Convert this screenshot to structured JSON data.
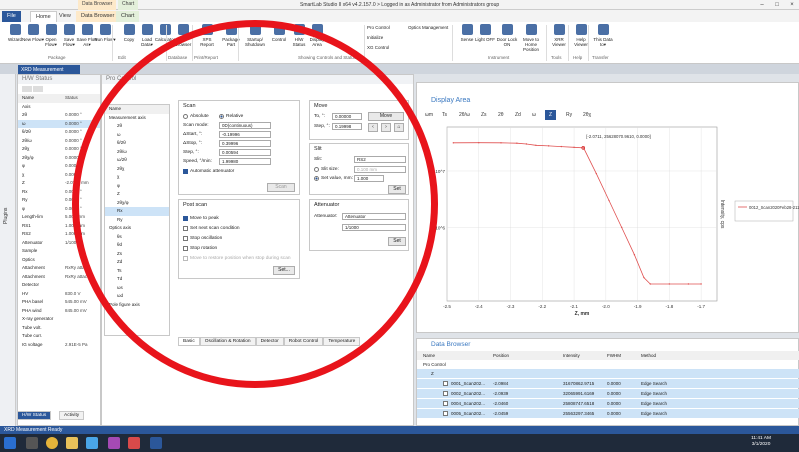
{
  "titlebar": {
    "title": "SmartLab Studio II x64 v4.2.157.0  > Logged in as Administrator from Administrators group",
    "ctx_tabs": [
      "Data Browser",
      "Chart"
    ]
  },
  "ribbon_tabs": [
    "File",
    "Home",
    "View",
    "Data Browser",
    "Chart"
  ],
  "ribbon": {
    "buttons": [
      {
        "label": "Wizard",
        "icon": "wizard-icon"
      },
      {
        "label": "New Flow▾",
        "icon": "new-flow-icon"
      },
      {
        "label": "Open Flow▾",
        "icon": "open-flow-icon"
      },
      {
        "label": "Save Flow▾",
        "icon": "save-flow-icon"
      },
      {
        "label": "Save Flow As▾",
        "icon": "save-flow-as-icon"
      },
      {
        "label": "Run Flow▾",
        "icon": "run-flow-icon"
      },
      {
        "label": "Copy",
        "icon": "copy-icon"
      },
      {
        "label": "Load Data▾",
        "icon": "load-data-icon"
      },
      {
        "label": "Calculator",
        "icon": "calculator-icon"
      },
      {
        "label": "DB Browser",
        "icon": "db-browser-icon"
      },
      {
        "label": "XPS Report",
        "icon": "xps-report-icon"
      },
      {
        "label": "Package Part",
        "icon": "package-part-icon"
      },
      {
        "label": "Startup/ Shutdown",
        "icon": "startup-icon"
      },
      {
        "label": "Control",
        "icon": "control-icon"
      },
      {
        "label": "H/W Status",
        "icon": "hw-status-icon"
      },
      {
        "label": "Display Area",
        "icon": "display-area-icon"
      },
      {
        "label": "Sense",
        "icon": "sense-icon"
      },
      {
        "label": "Light OFF",
        "icon": "light-icon"
      },
      {
        "label": "Door Lock ON",
        "icon": "door-lock-icon"
      },
      {
        "label": "Move to Home Position",
        "icon": "home-position-icon"
      },
      {
        "label": "XRR Viewer",
        "icon": "xrr-viewer-icon"
      },
      {
        "label": "Help Viewer",
        "icon": "help-viewer-icon"
      },
      {
        "label": "This Data to▾",
        "icon": "transfer-icon"
      }
    ],
    "small_cmds": [
      "Pro Control",
      "Initialize",
      "XG Control",
      "Optics Management"
    ],
    "groups": [
      "Package",
      "Edit",
      "Database",
      "Print/Report",
      "Showing Controls and Status",
      "Instrument",
      "Tools",
      "Help",
      "Transfer"
    ]
  },
  "doc_tab": "XRD Measurement",
  "plugins_label": "Plugins",
  "hw_status": {
    "title": "H/W Status",
    "col_name": "Name",
    "col_status": "Status",
    "rows": [
      {
        "name": "Axis",
        "value": ""
      },
      {
        "name": "2θ",
        "value": "0.0000 °"
      },
      {
        "name": "ω",
        "value": "0.0000 °"
      },
      {
        "name": "θ/2θ",
        "value": "0.0000 °"
      },
      {
        "name": "2θ/ω",
        "value": "0.0000 °"
      },
      {
        "name": "2θχ",
        "value": "0.0000 °"
      },
      {
        "name": "2θχ/φ",
        "value": "0.0000 °"
      },
      {
        "name": "φ",
        "value": "0.0000 °"
      },
      {
        "name": "χ",
        "value": "0.0000 °"
      },
      {
        "name": "Z",
        "value": "-2.0711 mm"
      },
      {
        "name": "Rx",
        "value": "0.0000 °"
      },
      {
        "name": "Ry",
        "value": "0.0000 °"
      },
      {
        "name": "φ",
        "value": "0.0000 °"
      },
      {
        "name": "Length-lim",
        "value": "5.000 mm"
      },
      {
        "name": "RS1",
        "value": "1.000 mm"
      },
      {
        "name": "RS2",
        "value": "1.000 mm"
      },
      {
        "name": "Attenuator",
        "value": "1/1000"
      },
      {
        "name": "Sample",
        "value": ""
      },
      {
        "name": "Optics",
        "value": ""
      },
      {
        "name": "Attachment",
        "value": "RxRy attac..."
      },
      {
        "name": "Attachment",
        "value": "RxRy attac..."
      },
      {
        "name": "Detector",
        "value": ""
      },
      {
        "name": "HV",
        "value": "830.0 V"
      },
      {
        "name": "PHA basel",
        "value": "545.00 mV"
      },
      {
        "name": "PHA wind",
        "value": "845.00 mV"
      },
      {
        "name": "X-ray generator",
        "value": ""
      },
      {
        "name": "Tube volt.",
        "value": ""
      },
      {
        "name": "Tube curr.",
        "value": ""
      },
      {
        "name": "IG voltage",
        "value": "2.91E-5 Pa"
      }
    ],
    "tabs": [
      "H/W Status",
      "Activity"
    ]
  },
  "measurement_control": {
    "title": "Pro Control",
    "tree_header": "Name",
    "tree_group1": "Measurement axis",
    "axes": [
      "2θ",
      "ω",
      "θ/2θ",
      "2θ/ω",
      "ω/2θ",
      "2θχ",
      "χ",
      "φ",
      "Z",
      "2θχ/φ",
      "Rx",
      "Ry"
    ],
    "tree_group2": "Optics axis",
    "optics": [
      "θs",
      "θd",
      "Zs",
      "Zd",
      "Ts",
      "Td",
      "ωs",
      "ωd"
    ],
    "tree_group3": "Pole figure axis",
    "scan": {
      "title": "Scan",
      "absolute": "Absolute",
      "relative": "Relative",
      "mode_label": "Scan mode:",
      "mode_value": "0D(continuous)",
      "start_label": "ΔStart, °:",
      "start_value": "-0.19996",
      "stop_label": "ΔStop, °:",
      "stop_value": "0.39996",
      "step_label": "Step, °:",
      "step_value": "0.00594",
      "speed_label": "Speed, °/min:",
      "speed_value": "1.99980",
      "auto_att": "Automatic attenuator",
      "scan_btn": "Scan"
    },
    "post_scan": {
      "title": "Post scan",
      "opts": [
        "Move to peak",
        "Set next scan condition",
        "Stop oscillation",
        "Stop rotation",
        "Move to restore position when stop during scan"
      ],
      "set_btn": "Set..."
    },
    "move": {
      "title": "Move",
      "to_label": "To, °:",
      "to_value": "0.00000",
      "step_label": "Step, °:",
      "step_value": "0.19998",
      "move_btn": "Move"
    },
    "slit": {
      "title": "Slit",
      "slit_label": "Slit:",
      "slit_value": "RS2",
      "slit_size": "Slit size:",
      "slit_size_val": "0.100 mm",
      "set_value": "Set value, mm:",
      "set_value_val": "1.000",
      "set_btn": "Set"
    },
    "attenuator": {
      "title": "Attenuator",
      "label": "Attenuator:",
      "value": "Attenuator",
      "ratio": "1/1000",
      "set_btn": "Set"
    },
    "bottom_tabs": [
      "Basic",
      "Oscillation & Rotation",
      "Detector",
      "Robot Control",
      "Temperature"
    ]
  },
  "display_area": {
    "title": "Display Area",
    "tabs": [
      "ωm",
      "Ts",
      "2θ/ω",
      "Zs",
      "2θ",
      "Zd",
      "ω",
      "Z",
      "Ry",
      "2θχ"
    ],
    "active_tab": "Z"
  },
  "chart_data": {
    "type": "line",
    "xlabel": "Z, mm",
    "ylabel": "Intensity, cps",
    "xlim": [
      -2.5,
      -1.65
    ],
    "x_ticks": [
      "-2.5",
      "-2.4",
      "-2.3",
      "-2.2",
      "-2.1",
      "-2.0",
      "-1.9",
      "-1.8",
      "-1.7"
    ],
    "y_ticks": [
      "10^8",
      "10^7",
      "10^6"
    ],
    "log_y": true,
    "legend": "0012_Scan2020Feb28-211904",
    "annotation": "[-2.0711, 25628070.9610, 0.0000]",
    "series": [
      {
        "name": "0012_Scan2020Feb28-211904",
        "color": "#e05050",
        "x": [
          -2.48,
          -2.4,
          -2.33,
          -2.28,
          -2.25,
          -2.22,
          -2.18,
          -2.14,
          -2.1,
          -2.07,
          -2.03,
          -1.99,
          -1.95,
          -1.91,
          -1.88,
          -1.86,
          -1.8,
          -1.74,
          -1.7
        ],
        "y": [
          31500000,
          31600000,
          31500000,
          31000000,
          30000000,
          28500000,
          27800000,
          27000000,
          26200000,
          25628070,
          9000000,
          3000000,
          1000000,
          330000,
          130000,
          100000,
          100000,
          100000,
          100000
        ]
      }
    ]
  },
  "data_browser": {
    "title": "Data Browser",
    "cols": [
      "Name",
      "Position",
      "Intensity",
      "FWHM",
      "Method"
    ],
    "group1": "Pro Control",
    "group2": "Z",
    "rows": [
      {
        "name": "0001_Scan202...",
        "pos": "-2.0984",
        "int": "31670862.9715",
        "fwhm": "0.0000",
        "method": "Edge Search"
      },
      {
        "name": "0002_Scan202...",
        "pos": "-2.0939",
        "int": "32065991.6169",
        "fwhm": "0.0000",
        "method": "Edge Search"
      },
      {
        "name": "0004_Scan202...",
        "pos": "-2.0460",
        "int": "25808747.6518",
        "fwhm": "0.0000",
        "method": "Edge Search"
      },
      {
        "name": "0005_Scan202...",
        "pos": "-2.0459",
        "int": "25563297.3465",
        "fwhm": "0.0000",
        "method": "Edge Search"
      }
    ]
  },
  "status": "XRD Measurement  Ready",
  "clock": {
    "time": "11:41 AM",
    "date": "3/1/2020"
  },
  "colors": {
    "accent": "#2b579a",
    "annotation": "#e8141b",
    "series": "#e05050"
  }
}
